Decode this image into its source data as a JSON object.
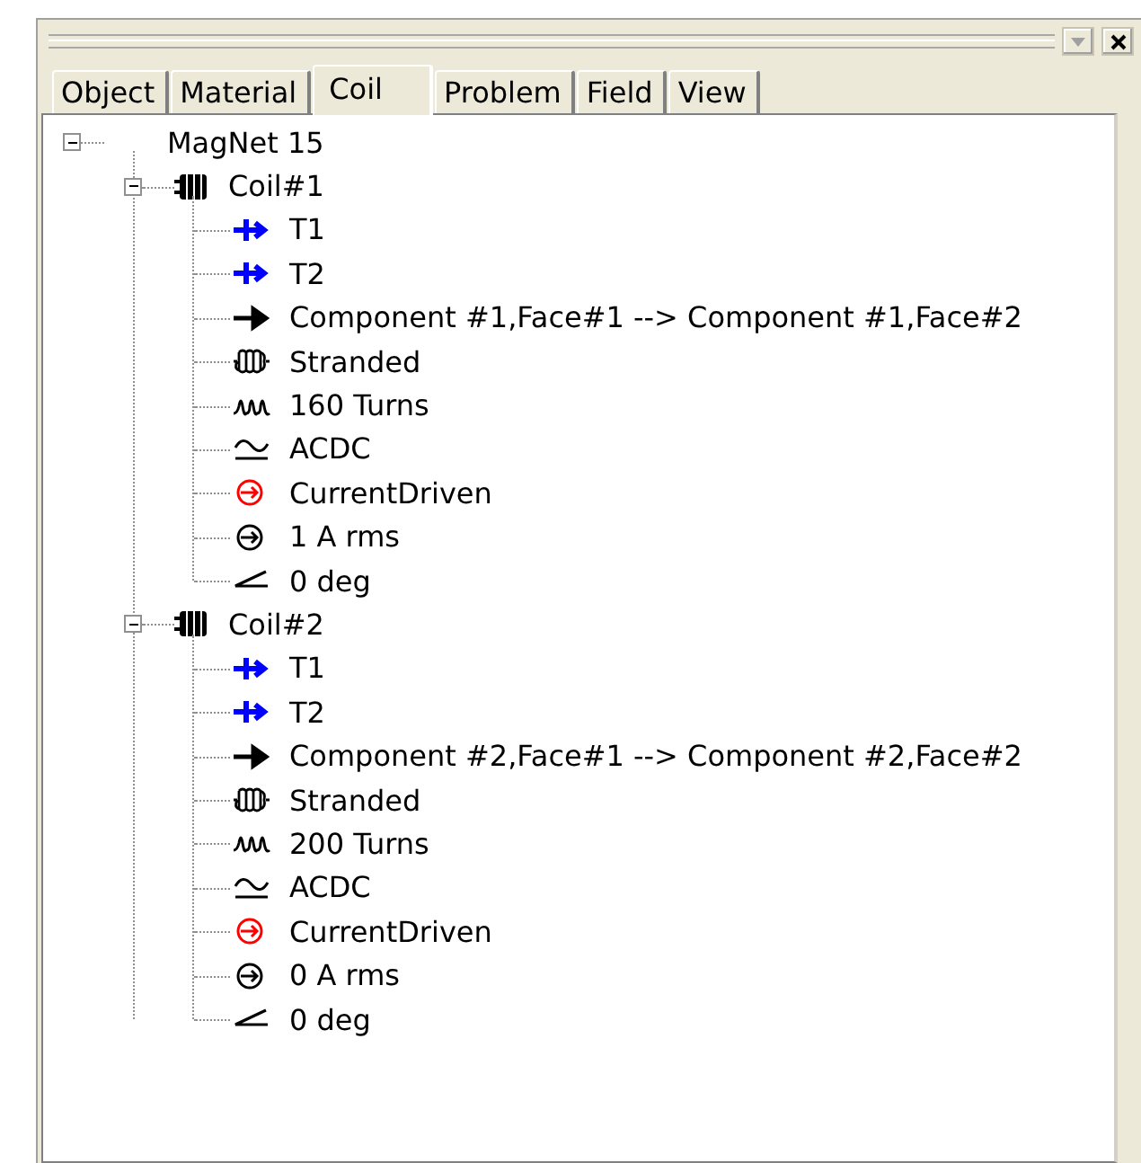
{
  "tabs": [
    {
      "label": "Object",
      "selected": false
    },
    {
      "label": "Material",
      "selected": false
    },
    {
      "label": "Coil",
      "selected": true
    },
    {
      "label": "Problem",
      "selected": false
    },
    {
      "label": "Field",
      "selected": false
    },
    {
      "label": "View",
      "selected": false
    }
  ],
  "tree": {
    "label": "MagNet 15",
    "expanded": true,
    "children": [
      {
        "label": "Coil#1",
        "expanded": true,
        "children": [
          {
            "kind": "terminal",
            "label": "T1"
          },
          {
            "kind": "terminal",
            "label": "T2"
          },
          {
            "kind": "path",
            "label": "Component #1,Face#1 --> Component #1,Face#2"
          },
          {
            "kind": "stranded",
            "label": "Stranded"
          },
          {
            "kind": "turns",
            "label": "160 Turns"
          },
          {
            "kind": "waveform",
            "label": "ACDC"
          },
          {
            "kind": "drive",
            "label": "CurrentDriven"
          },
          {
            "kind": "amplitude",
            "label": "1 A rms"
          },
          {
            "kind": "phase",
            "label": "0 deg"
          }
        ]
      },
      {
        "label": "Coil#2",
        "expanded": true,
        "children": [
          {
            "kind": "terminal",
            "label": "T1"
          },
          {
            "kind": "terminal",
            "label": "T2"
          },
          {
            "kind": "path",
            "label": "Component #2,Face#1 --> Component #2,Face#2"
          },
          {
            "kind": "stranded",
            "label": "Stranded"
          },
          {
            "kind": "turns",
            "label": "200 Turns"
          },
          {
            "kind": "waveform",
            "label": "ACDC"
          },
          {
            "kind": "drive",
            "label": "CurrentDriven"
          },
          {
            "kind": "amplitude",
            "label": "0 A rms"
          },
          {
            "kind": "phase",
            "label": "0 deg"
          }
        ]
      }
    ]
  }
}
